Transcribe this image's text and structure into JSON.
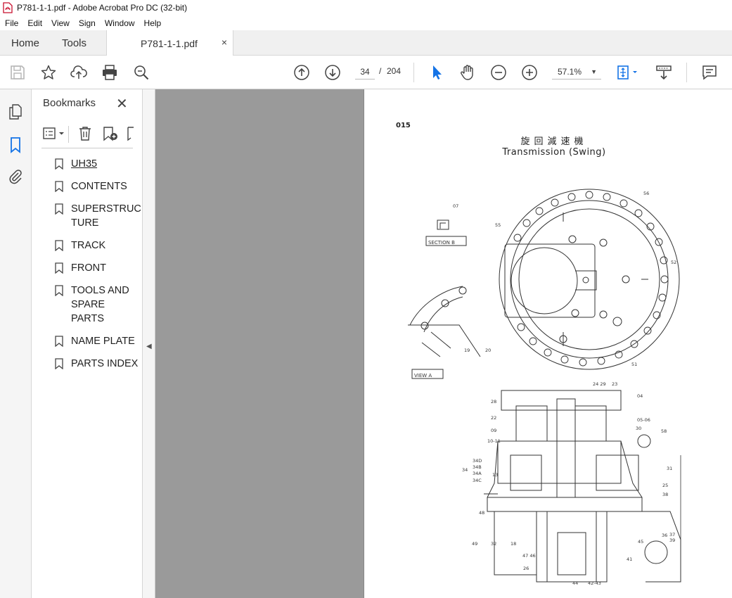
{
  "window": {
    "title": "P781-1-1.pdf - Adobe Acrobat Pro DC (32-bit)"
  },
  "menu": [
    "File",
    "Edit",
    "View",
    "Sign",
    "Window",
    "Help"
  ],
  "tabs": {
    "home": "Home",
    "tools": "Tools",
    "document": "P781-1-1.pdf",
    "close_glyph": "×"
  },
  "toolbar": {
    "current_page": "34",
    "page_separator": "/",
    "total_pages": "204",
    "zoom": "57.1%",
    "icons": [
      "save-icon",
      "star-icon",
      "upload-icon",
      "print-icon",
      "search-zoom-icon",
      "page-up-icon",
      "page-down-icon",
      "select-cursor-icon",
      "hand-icon",
      "zoom-out-icon",
      "zoom-in-icon",
      "fit-page-icon",
      "scroll-mode-icon",
      "comment-icon"
    ]
  },
  "bookmarks": {
    "header": "Bookmarks",
    "close_glyph": "✕",
    "items": [
      {
        "label": "UH35",
        "active": true
      },
      {
        "label": "CONTENTS"
      },
      {
        "label": "SUPERSTRUC TURE"
      },
      {
        "label": "TRACK"
      },
      {
        "label": "FRONT"
      },
      {
        "label": "TOOLS AND SPARE PARTS"
      },
      {
        "label": "NAME PLATE"
      },
      {
        "label": "PARTS INDEX"
      }
    ]
  },
  "document": {
    "page_number": "015",
    "title_jp": "旋回減速機",
    "title_en": "Transmission (Swing)",
    "section_label": "SECTION B",
    "view_label": "VIEW A",
    "callouts": [
      "07",
      "56",
      "55",
      "52",
      "19",
      "20",
      "51",
      "24",
      "29",
      "23",
      "04",
      "28",
      "22",
      "05-06",
      "09",
      "30",
      "58",
      "10-11",
      "34D",
      "34B",
      "34A",
      "34C",
      "34",
      "13",
      "31",
      "25",
      "38",
      "48",
      "49",
      "32",
      "18",
      "47",
      "46",
      "36",
      "37",
      "39",
      "45",
      "26",
      "41",
      "44",
      "42-43"
    ]
  }
}
